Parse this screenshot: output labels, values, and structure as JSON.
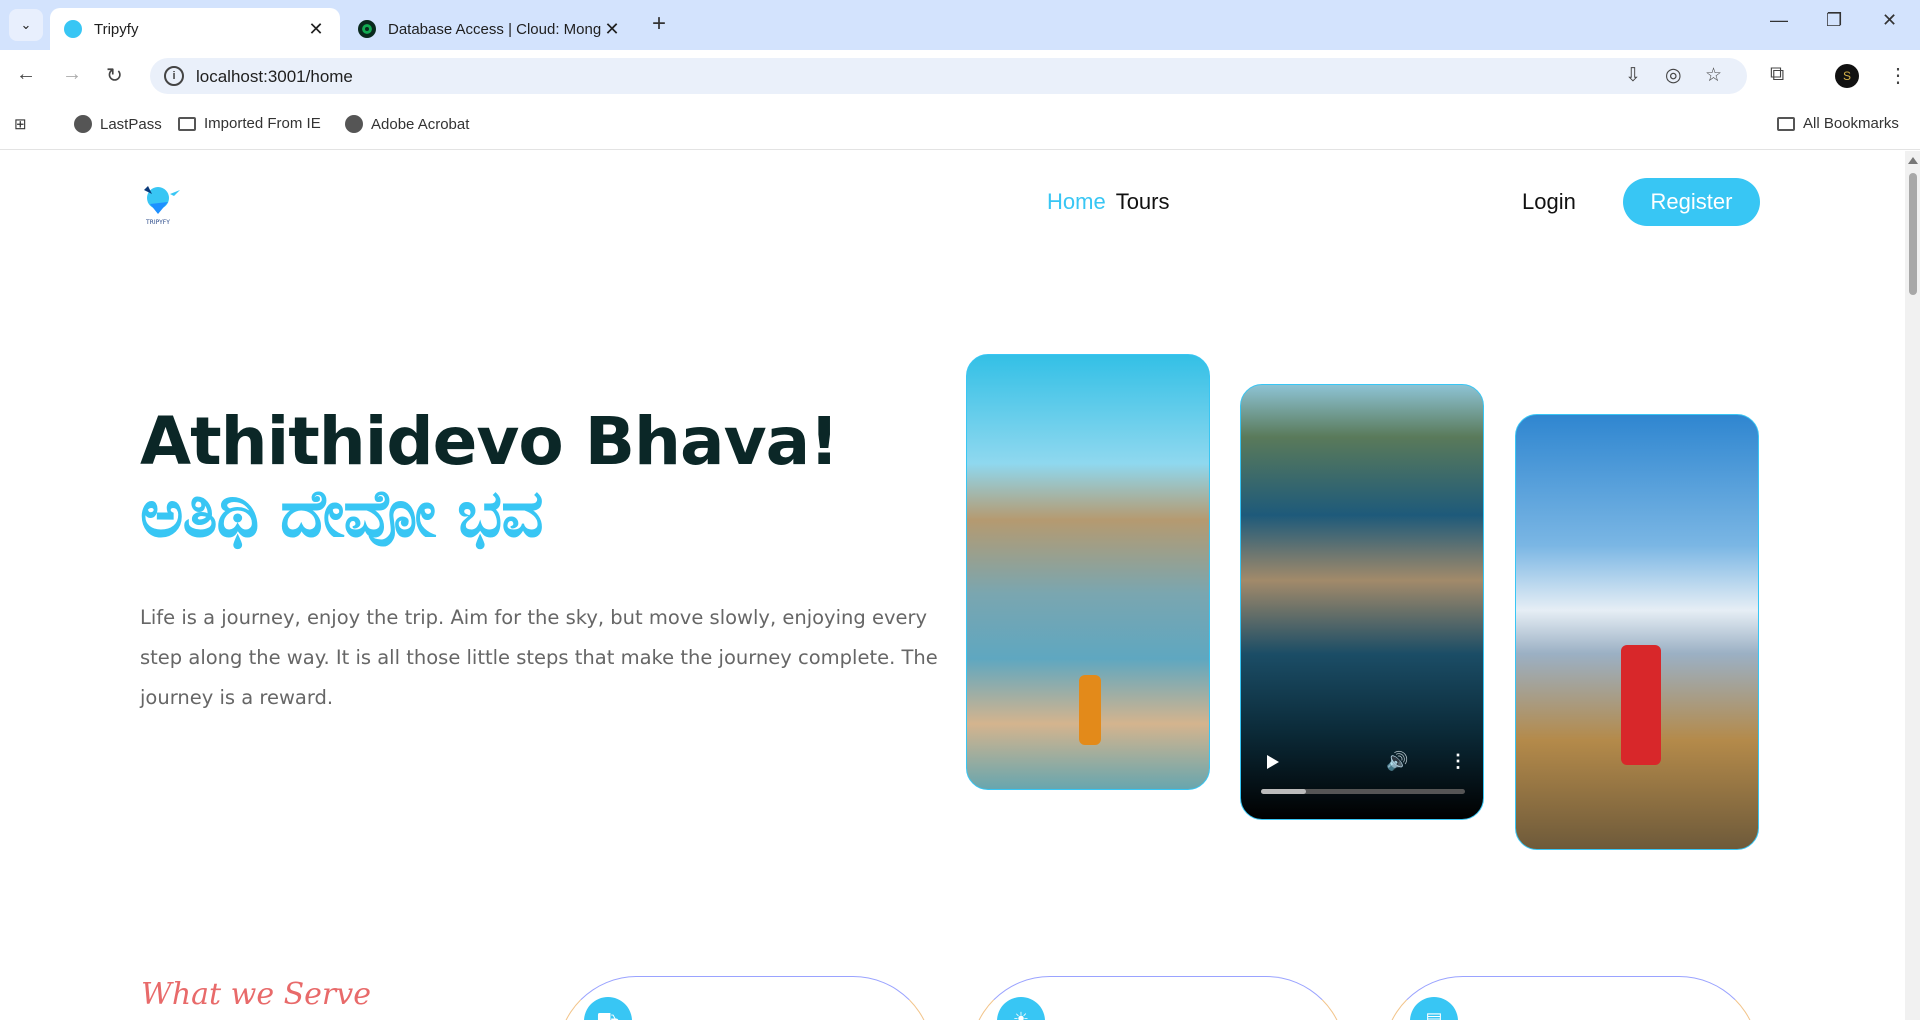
{
  "browser": {
    "tabs": [
      {
        "title": "Tripyfy",
        "active": true
      },
      {
        "title": "Database Access | Cloud: Mong",
        "active": false
      }
    ],
    "url": "localhost:3001/home",
    "bookmarks": [
      "LastPass",
      "Imported From IE",
      "Adobe Acrobat"
    ],
    "all_bookmarks": "All Bookmarks",
    "profile_initial": "S"
  },
  "site": {
    "logo_text": "TRIPYFY",
    "nav": {
      "home": "Home",
      "tours": "Tours"
    },
    "login": "Login",
    "register": "Register",
    "accent": "#38c6f4"
  },
  "hero": {
    "title": "Athithidevo Bhava!",
    "title_kannada": "ಅತಿಥಿ ದೇವೋ ಭವ",
    "text": "Life is a journey, enjoy the trip. Aim for the sky, but move slowly, enjoying every step along the way. It is all those little steps that make the journey complete. The journey is a reward.",
    "video_progress": 0.22
  },
  "services": {
    "heading": "What we Serve"
  }
}
